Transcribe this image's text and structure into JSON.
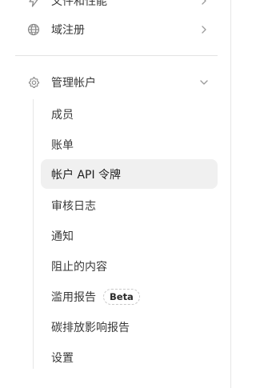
{
  "nav": {
    "top_item": {
      "label": "文件和性能",
      "icon": "lightning-icon"
    },
    "domain_item": {
      "label": "域注册",
      "icon": "globe-icon"
    },
    "manage_account": {
      "label": "管理帐户",
      "icon": "gear-icon",
      "expanded": true,
      "children": [
        {
          "label": "成员"
        },
        {
          "label": "账单"
        },
        {
          "label": "帐户 API 令牌",
          "active": true
        },
        {
          "label": "审核日志"
        },
        {
          "label": "通知"
        },
        {
          "label": "阻止的内容"
        },
        {
          "label": "滥用报告",
          "badge": "Beta"
        },
        {
          "label": "碳排放影响报告"
        },
        {
          "label": "设置"
        }
      ]
    }
  },
  "colors": {
    "active_bg": "#f0f0f0",
    "text": "#3a3a3a",
    "icon": "#8a8a8a",
    "border": "#e6e6e6"
  }
}
